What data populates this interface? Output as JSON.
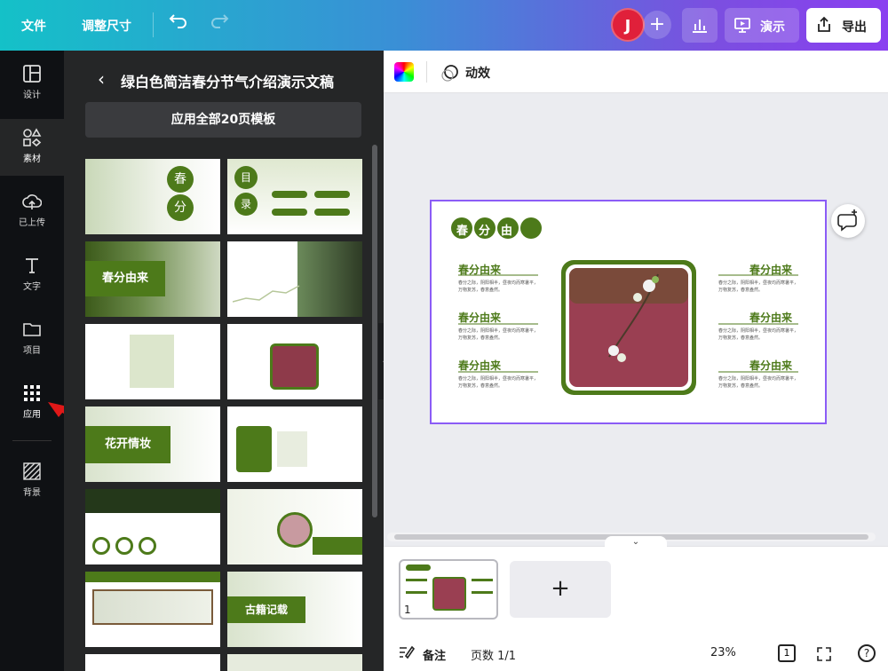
{
  "topbar": {
    "file_label": "文件",
    "resize_label": "调整尺寸",
    "avatar_initial": "J",
    "plus_label": "+",
    "present_label": "演示",
    "export_label": "导出"
  },
  "leftnav": {
    "items": [
      {
        "label": "设计",
        "icon": "layout-icon"
      },
      {
        "label": "素材",
        "icon": "shapes-icon"
      },
      {
        "label": "已上传",
        "icon": "cloud-upload-icon"
      },
      {
        "label": "文字",
        "icon": "text-icon"
      },
      {
        "label": "项目",
        "icon": "folder-icon"
      },
      {
        "label": "应用",
        "icon": "apps-grid-icon"
      },
      {
        "label": "背景",
        "icon": "background-pattern-icon"
      }
    ],
    "active_index": 5
  },
  "panel": {
    "title": "绿白色简洁春分节气介绍演示文稿",
    "apply_all_label": "应用全部20页模板",
    "thumb_labels": [
      "春",
      "分",
      "目",
      "录",
      "春分由来",
      "花开情妆",
      "古籍记载"
    ]
  },
  "canvas_toolbar": {
    "animate_label": "动效"
  },
  "slide": {
    "title": "春分由来",
    "section_heading": "春分由来",
    "body_text": "春分之际，阴阳相半，昼夜均而寒暑平，万物复苏，春意盎然。"
  },
  "bottom": {
    "page_number": "1",
    "add_page_label": "+",
    "notes_label": "备注",
    "page_count_label": "页数 1/1",
    "zoom_label": "23%",
    "pages_icon_number": "1",
    "help_label": "?"
  },
  "colors": {
    "accent_green": "#4d7a1a",
    "selection_purple": "#8b5cf6",
    "avatar_red": "#e0203a"
  }
}
